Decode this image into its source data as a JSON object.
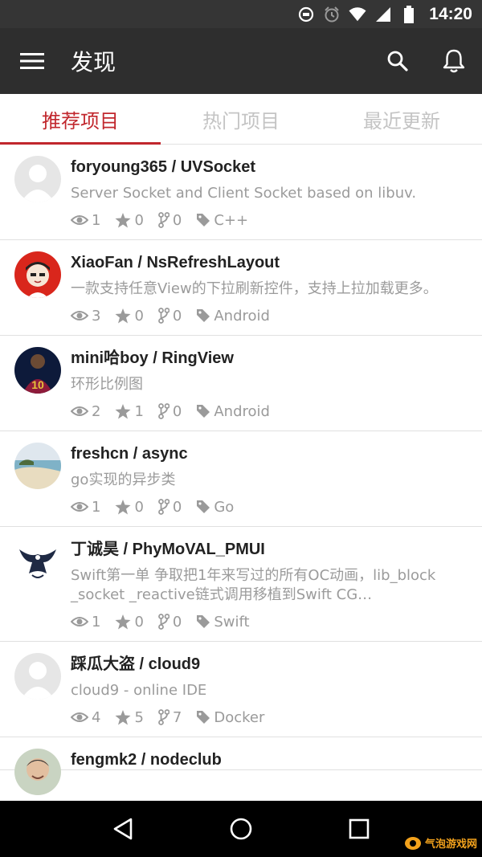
{
  "status_bar": {
    "time": "14:20",
    "icons": [
      "sync-icon",
      "alarm-icon",
      "wifi-icon",
      "signal-icon",
      "battery-icon"
    ]
  },
  "app_bar": {
    "title": "发现",
    "icons": [
      "menu-icon",
      "search-icon",
      "bell-icon"
    ]
  },
  "tabs": [
    {
      "label": "推荐项目",
      "active": true
    },
    {
      "label": "热门项目",
      "active": false
    },
    {
      "label": "最近更新",
      "active": false
    }
  ],
  "repos": [
    {
      "title": "foryoung365 / UVSocket",
      "desc": "Server Socket and Client Socket based on libuv.",
      "watchers": "1",
      "stars": "0",
      "forks": "0",
      "lang": "C++"
    },
    {
      "title": "XiaoFan / NsRefreshLayout",
      "desc": "一款支持任意View的下拉刷新控件，支持上拉加载更多。",
      "watchers": "3",
      "stars": "0",
      "forks": "0",
      "lang": "Android"
    },
    {
      "title": "mini哈boy / RingView",
      "desc": "环形比例图",
      "watchers": "2",
      "stars": "1",
      "forks": "0",
      "lang": "Android"
    },
    {
      "title": "freshcn / async",
      "desc": "go实现的异步类",
      "watchers": "1",
      "stars": "0",
      "forks": "0",
      "lang": "Go"
    },
    {
      "title": "丁诚昊 / PhyMoVAL_PMUI",
      "desc": "Swift第一单 争取把1年来写过的所有OC动画，lib_block _socket _reactive链式调用移植到Swift CG…",
      "watchers": "1",
      "stars": "0",
      "forks": "0",
      "lang": "Swift"
    },
    {
      "title": "踩瓜大盗 / cloud9",
      "desc": "cloud9 - online IDE",
      "watchers": "4",
      "stars": "5",
      "forks": "7",
      "lang": "Docker"
    },
    {
      "title": "fengmk2 / nodeclub",
      "desc": "",
      "watchers": "",
      "stars": "",
      "forks": "",
      "lang": ""
    }
  ],
  "watermark": {
    "text": "气泡游戏网"
  },
  "colors": {
    "accent": "#c1272d",
    "app_bar": "#2e2e2e",
    "status_bar": "#353535"
  }
}
